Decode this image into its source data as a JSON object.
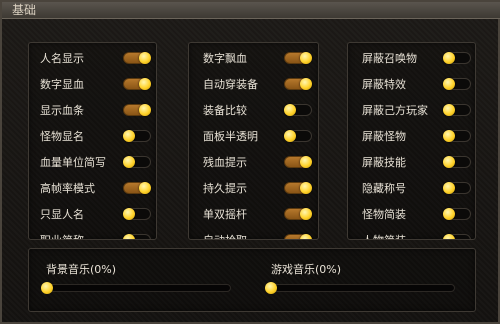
{
  "window": {
    "title": "基础"
  },
  "columns": [
    [
      {
        "label": "人名显示",
        "on": true
      },
      {
        "label": "数字显血",
        "on": true
      },
      {
        "label": "显示血条",
        "on": true
      },
      {
        "label": "怪物显名",
        "on": false
      },
      {
        "label": "血量单位简写",
        "on": false
      },
      {
        "label": "高帧率模式",
        "on": true
      },
      {
        "label": "只显人名",
        "on": false
      },
      {
        "label": "职业简称",
        "on": false
      }
    ],
    [
      {
        "label": "数字飘血",
        "on": true
      },
      {
        "label": "自动穿装备",
        "on": true
      },
      {
        "label": "装备比较",
        "on": false
      },
      {
        "label": "面板半透明",
        "on": false
      },
      {
        "label": "残血提示",
        "on": true
      },
      {
        "label": "持久提示",
        "on": true
      },
      {
        "label": "单双摇杆",
        "on": true
      },
      {
        "label": "自动拾取",
        "on": true
      }
    ],
    [
      {
        "label": "屏蔽召唤物",
        "on": false
      },
      {
        "label": "屏蔽特效",
        "on": false
      },
      {
        "label": "屏蔽己方玩家",
        "on": false
      },
      {
        "label": "屏蔽怪物",
        "on": false
      },
      {
        "label": "屏蔽技能",
        "on": false
      },
      {
        "label": "隐藏称号",
        "on": false
      },
      {
        "label": "怪物简装",
        "on": false
      },
      {
        "label": "人物简装",
        "on": false
      }
    ]
  ],
  "audio": {
    "bgm_label": "背景音乐(0%)",
    "bgm_level": 0,
    "game_label": "游戏音乐(0%)",
    "game_level": 0
  },
  "colors": {
    "toggle_on": "#a8691f",
    "toggle_off": "#0b0a09",
    "knob": "#ffd22a",
    "text": "#e8e2d6"
  }
}
